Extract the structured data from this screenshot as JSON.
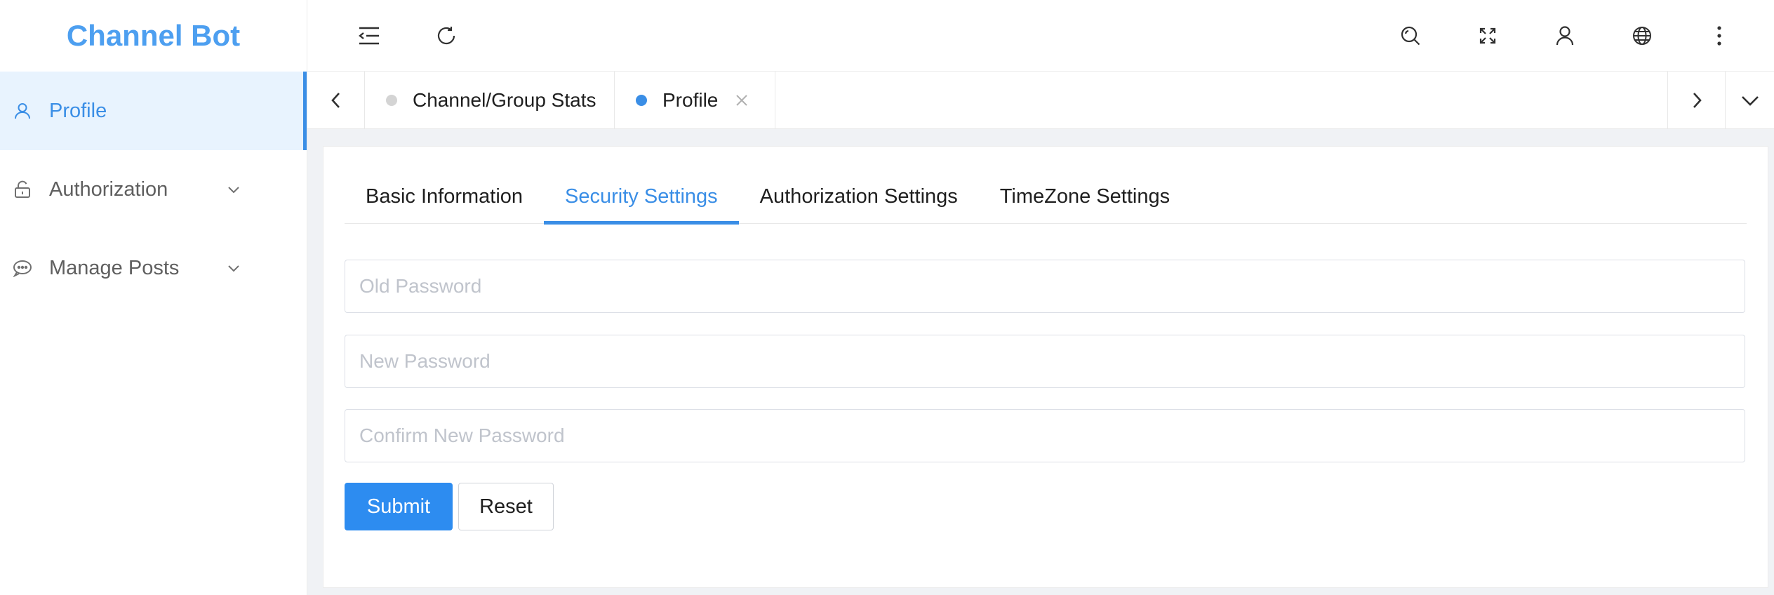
{
  "app": {
    "title": "Channel Bot"
  },
  "sidebar": {
    "items": [
      {
        "label": "Profile",
        "icon": "user-icon",
        "active": true
      },
      {
        "label": "Authorization",
        "icon": "lock-icon",
        "expandable": true
      },
      {
        "label": "Manage Posts",
        "icon": "chat-icon",
        "expandable": true
      }
    ]
  },
  "header": {
    "icons": [
      "menu-collapse-icon",
      "refresh-icon",
      "search-icon",
      "fullscreen-icon",
      "user-icon",
      "globe-icon",
      "more-vertical-icon"
    ]
  },
  "open_tabs": [
    {
      "label": "Channel/Group Stats",
      "active": false,
      "dot_color": "#d4d4d4"
    },
    {
      "label": "Profile",
      "active": true,
      "dot_color": "#3a8ee6",
      "closable": true
    }
  ],
  "profile_tabs": [
    {
      "label": "Basic Information",
      "active": false
    },
    {
      "label": "Security Settings",
      "active": true
    },
    {
      "label": "Authorization Settings",
      "active": false
    },
    {
      "label": "TimeZone Settings",
      "active": false
    }
  ],
  "form": {
    "old_password": {
      "placeholder": "Old Password",
      "value": ""
    },
    "new_password": {
      "placeholder": "New Password",
      "value": ""
    },
    "confirm_password": {
      "placeholder": "Confirm New Password",
      "value": ""
    },
    "submit_label": "Submit",
    "reset_label": "Reset"
  },
  "colors": {
    "accent": "#3a8ee6",
    "brand": "#4d9ff0",
    "primary_button": "#2d8cf0",
    "active_menu_bg": "#e8f3fe"
  }
}
